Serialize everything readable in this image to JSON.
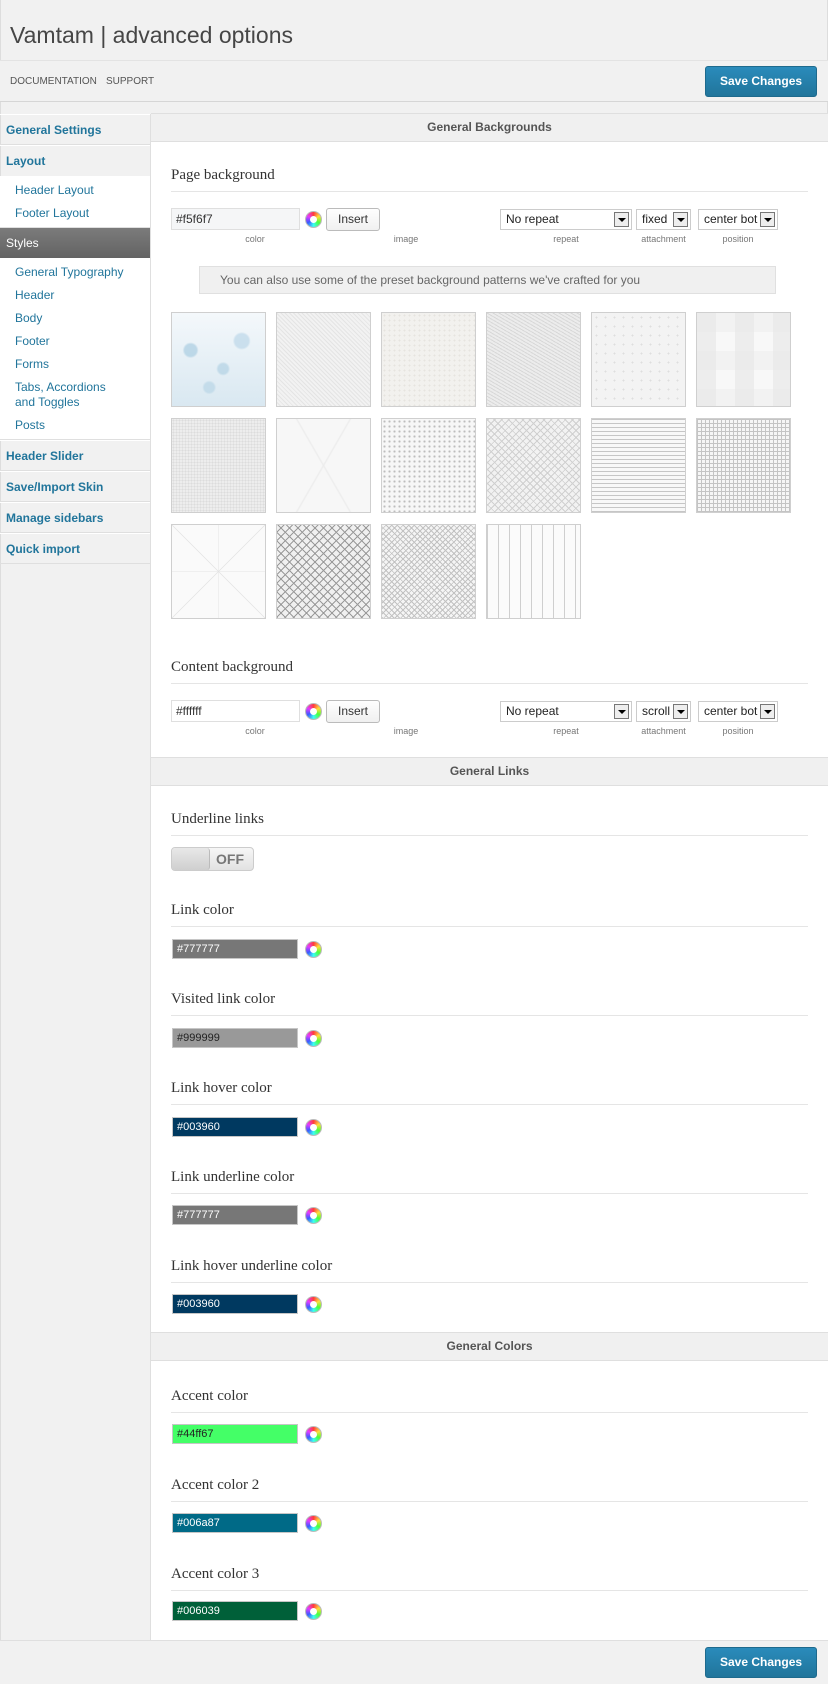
{
  "app": {
    "title": "Vamtam | advanced options"
  },
  "topbar": {
    "documentation": "DOCUMENTATION",
    "support": "SUPPORT",
    "save_label": "Save Changes"
  },
  "sidebar": {
    "general_settings": "General Settings",
    "layout": "Layout",
    "layout_items": [
      "Header Layout",
      "Footer Layout"
    ],
    "styles": "Styles",
    "styles_items": [
      "General Typography",
      "Header",
      "Body",
      "Footer",
      "Forms",
      "Tabs, Accordions and Toggles",
      "Posts"
    ],
    "header_slider": "Header Slider",
    "save_import_skin": "Save/Import Skin",
    "manage_sidebars": "Manage sidebars",
    "quick_import": "Quick import"
  },
  "sections": {
    "backgrounds": "General Backgrounds",
    "links": "General Links",
    "colors": "General Colors"
  },
  "captions": {
    "color": "color",
    "image": "image",
    "repeat": "repeat",
    "attachment": "attachment",
    "position": "position"
  },
  "page_background": {
    "title": "Page background",
    "color": "#f5f6f7",
    "insert_label": "Insert",
    "repeat": "No repeat",
    "attachment": "fixed",
    "position": "center bot",
    "hint": "You can also use some of the preset background patterns we've crafted for you"
  },
  "patterns": [
    "bokeh",
    "diagonal-fine",
    "paper-speckle",
    "diagonal-weave",
    "paper-dots",
    "soft-squares",
    "noise",
    "diagonal-x",
    "dots",
    "diamond-weave",
    "horizontal-lines",
    "grid-fine",
    "lattice",
    "diamond-mesh",
    "cross-hatch",
    "vertical-lines"
  ],
  "content_background": {
    "title": "Content background",
    "color": "#ffffff",
    "insert_label": "Insert",
    "repeat": "No repeat",
    "attachment": "scroll",
    "position": "center bot"
  },
  "links": {
    "underline_title": "Underline links",
    "underline_state": "OFF",
    "items": [
      {
        "label": "Link color",
        "value": "#777777",
        "bg": "#777777",
        "fg": "#ffffff"
      },
      {
        "label": "Visited link color",
        "value": "#999999",
        "bg": "#999999",
        "fg": "#222222"
      },
      {
        "label": "Link hover color",
        "value": "#003960",
        "bg": "#003960",
        "fg": "#ffffff"
      },
      {
        "label": "Link underline color",
        "value": "#777777",
        "bg": "#777777",
        "fg": "#ffffff"
      },
      {
        "label": "Link hover underline color",
        "value": "#003960",
        "bg": "#003960",
        "fg": "#ffffff"
      }
    ]
  },
  "colors": {
    "items": [
      {
        "label": "Accent color",
        "value": "#44ff67",
        "bg": "#44ff67",
        "fg": "#222222"
      },
      {
        "label": "Accent color 2",
        "value": "#006a87",
        "bg": "#006a87",
        "fg": "#ffffff"
      },
      {
        "label": "Accent color 3",
        "value": "#006039",
        "bg": "#006039",
        "fg": "#ffffff"
      }
    ]
  }
}
